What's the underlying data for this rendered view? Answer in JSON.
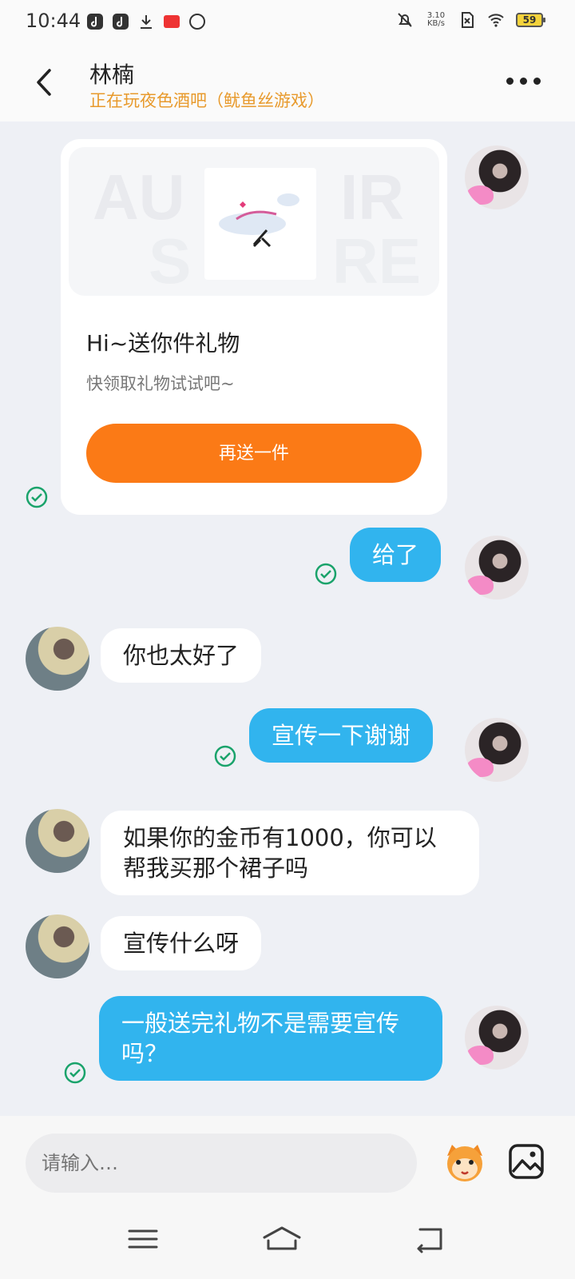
{
  "status_bar": {
    "time": "10:44",
    "net_speed_value": "3.10",
    "net_speed_unit": "KB/s",
    "battery": "59"
  },
  "header": {
    "name": "林楠",
    "status": "正在玩夜色酒吧（鱿鱼丝游戏）"
  },
  "gift_card": {
    "title": "Hi~送你件礼物",
    "description": "快领取礼物试试吧~",
    "button_label": "再送一件"
  },
  "messages": [
    {
      "side": "mine",
      "text": "给了"
    },
    {
      "side": "theirs",
      "text": "你也太好了"
    },
    {
      "side": "mine",
      "text": "宣传一下谢谢"
    },
    {
      "side": "theirs",
      "text": "如果你的金币有1000，你可以帮我买那个裙子吗"
    },
    {
      "side": "theirs",
      "text": "宣传什么呀"
    },
    {
      "side": "mine",
      "text": "一般送完礼物不是需要宣传吗？"
    }
  ],
  "composer": {
    "placeholder": "请输入…"
  },
  "colors": {
    "accent_blue": "#31b4ee",
    "gift_orange": "#fb7a16",
    "status_orange": "#e89a2c",
    "check_green": "#1aa36b"
  }
}
